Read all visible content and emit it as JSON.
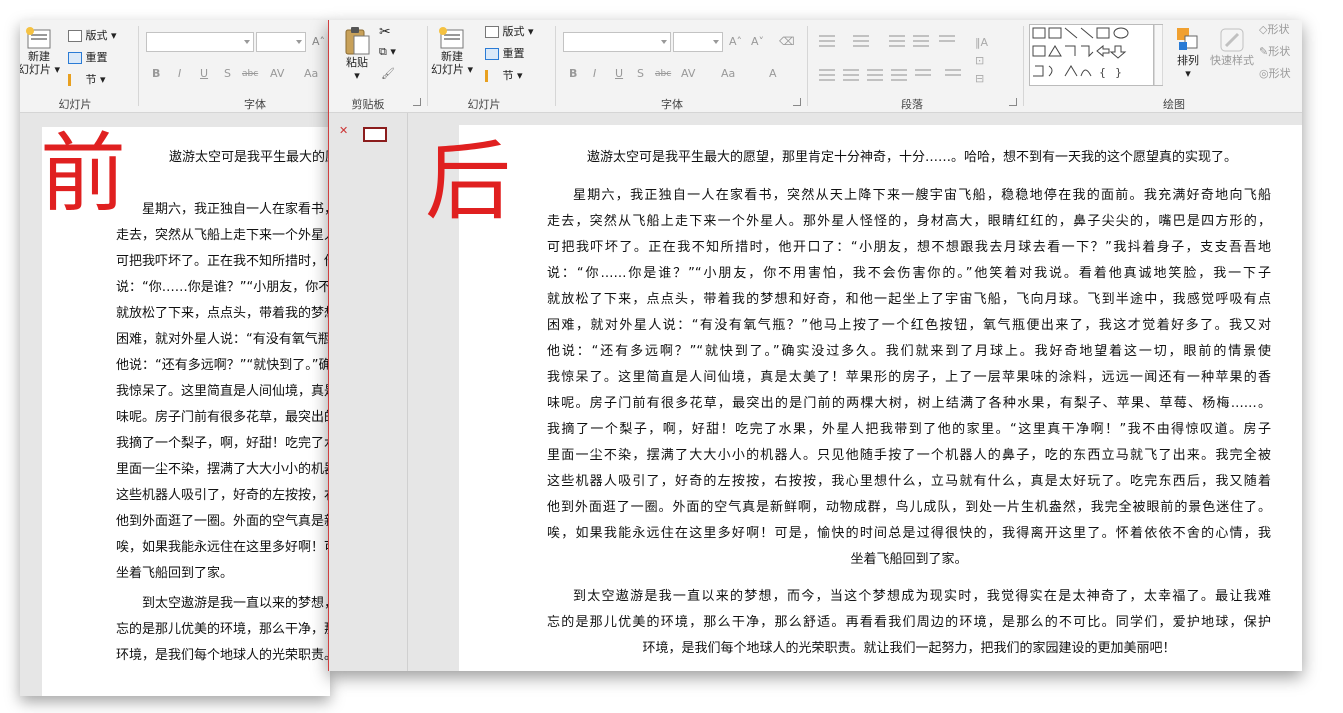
{
  "labels": {
    "before": "前",
    "after": "后"
  },
  "ribbon": {
    "clipboard": {
      "group": "剪贴板",
      "paste": "粘贴"
    },
    "slides": {
      "group": "幻灯片",
      "new_slide_line1": "新建",
      "new_slide_line2": "幻灯片",
      "layout": "版式",
      "reset": "重置",
      "section": "节"
    },
    "font": {
      "group": "字体",
      "bold": "B",
      "italic": "I",
      "underline": "U",
      "shadow": "S",
      "strike": "abc",
      "spacing": "AV",
      "case": "Aa",
      "color": "A"
    },
    "paragraph": {
      "group": "段落"
    },
    "drawing": {
      "group": "绘图",
      "arrange": "排列",
      "quick_styles": "快速样式",
      "shape_fill": "形状",
      "shape_outline": "形状",
      "shape_effects": "形状"
    }
  },
  "left_ribbon": {
    "new_slide_line1": "新建",
    "new_slide_line2": "幻灯片",
    "layout": "版式",
    "reset": "重置",
    "section": "节",
    "slides_group": "幻灯片",
    "font_group": "字体"
  },
  "document": {
    "title": "遨游太空可是我平生最大的愿望，那里肯定十分神奇，十分……。哈哈，想不到有一天我的这个愿望真的实现了。",
    "para1_lines": [
      "星期六，我正独自一人在家看书，突然从天上降下来一艘宇宙飞船，稳稳地停在我的面前。我充满好奇地向飞船",
      "走去，突然从飞船上走下来一个外星人。那外星人怪怪的，身材高大，眼睛红红的，鼻子尖尖的，嘴巴是四方形的，",
      "可把我吓坏了。正在我不知所措时，他开口了：“小朋友，想不想跟我去月球去看一下？”我抖着身子，支支吾吾地",
      "说：“你……你是谁？”“小朋友，你不用害怕，我不会伤害你的。”他笑着对我说。看着他真诚地笑脸，我一下子",
      "就放松了下来，点点头，带着我的梦想和好奇，和他一起坐上了宇宙飞船，飞向月球。飞到半途中，我感觉呼吸有点",
      "困难，就对外星人说：“有没有氧气瓶？”他马上按了一个红色按钮，氧气瓶便出来了，我这才觉着好多了。我又对",
      "他说：“还有多远啊？”“就快到了。”确实没过多久。我们就来到了月球上。我好奇地望着这一切，眼前的情景使",
      "我惊呆了。这里简直是人间仙境，真是太美了！苹果形的房子，上了一层苹果味的涂料，远远一闻还有一种苹果的香",
      "味呢。房子门前有很多花草，最突出的是门前的两棵大树，树上结满了各种水果，有梨子、苹果、草莓、杨梅……。",
      "我摘了一个梨子，啊，好甜！吃完了水果，外星人把我带到了他的家里。“这里真干净啊！”我不由得惊叹道。房子",
      "里面一尘不染，摆满了大大小小的机器人。只见他随手按了一个机器人的鼻子，吃的东西立马就飞了出来。我完全被",
      "这些机器人吸引了，好奇的左按按，右按按，我心里想什么，立马就有什么，真是太好玩了。吃完东西后，我又随着",
      "他到外面逛了一圈。外面的空气真是新鲜啊，动物成群，鸟儿成队，到处一片生机盎然，我完全被眼前的景色迷住了。",
      "唉，如果我能永远住在这里多好啊！可是，愉快的时间总是过得很快的，我得离开这里了。怀着依依不舍的心情，我",
      "坐着飞船回到了家。"
    ],
    "para2_lines": [
      "到太空遨游是我一直以来的梦想，而今，当这个梦想成为现实时，我觉得实在是太神奇了，太幸福了。最让我难",
      "忘的是那儿优美的环境，那么干净，那么舒适。再看看我们周边的环境，是那么的不可比。同学们，爱护地球，保护",
      "环境，是我们每个地球人的光荣职责。就让我们一起努力，把我们的家园建设的更加美丽吧！"
    ]
  },
  "colors": {
    "accent_red": "#e02020",
    "ribbon_bg": "#f3f3f3",
    "workspace": "#e6e6e6"
  }
}
